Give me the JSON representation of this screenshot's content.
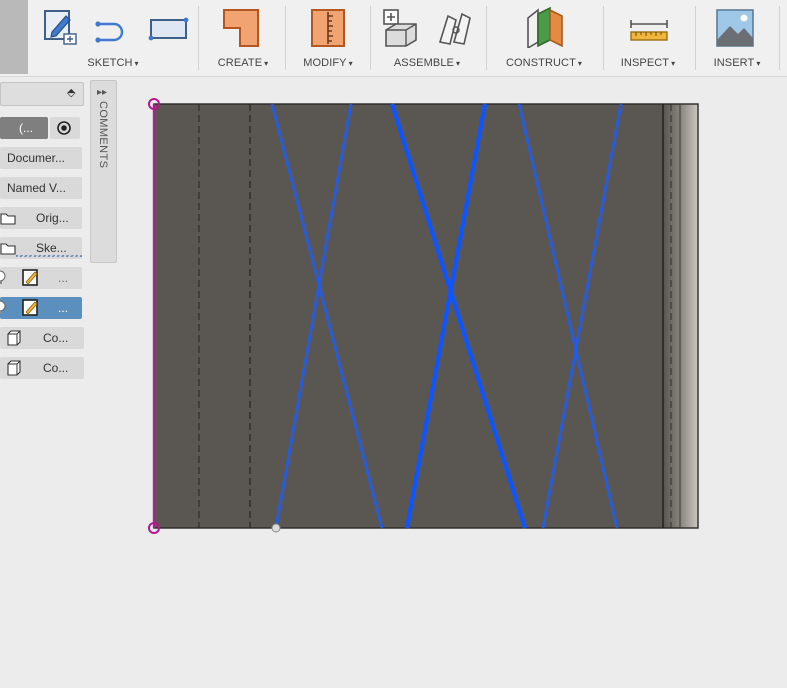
{
  "toolbar": {
    "groups": {
      "sketch": "SKETCH",
      "create": "CREATE",
      "modify": "MODIFY",
      "assemble": "ASSEMBLE",
      "construct": "CONSTRUCT",
      "inspect": "INSPECT",
      "insert": "INSERT"
    },
    "dropdown_caret": "▾"
  },
  "browser": {
    "collapse_glyph": "⬘",
    "rows": [
      {
        "label": "(...",
        "icon": "target-icon"
      },
      {
        "label": "Documer...",
        "icon": "gear-icon"
      },
      {
        "label": "Named V...",
        "icon": "folder-icon"
      },
      {
        "label": "Orig...",
        "icon": "folder-icon"
      },
      {
        "label": "Ske...",
        "icon": "folder-icon"
      },
      {
        "label": "...",
        "icon": "sketch-icon"
      },
      {
        "label": "...",
        "icon": "sketch-icon",
        "selected": true
      },
      {
        "label": "Co...",
        "icon": "component-icon"
      },
      {
        "label": "Co...",
        "icon": "component-icon"
      }
    ]
  },
  "comments": {
    "expand_glyph": "▸▸",
    "label": "COMMENTS"
  },
  "colors": {
    "body": "#5a5752",
    "sketch_line": "#1a5cff",
    "constraint_line": "#9b2a86",
    "selection_row": "#5a8fbe"
  }
}
